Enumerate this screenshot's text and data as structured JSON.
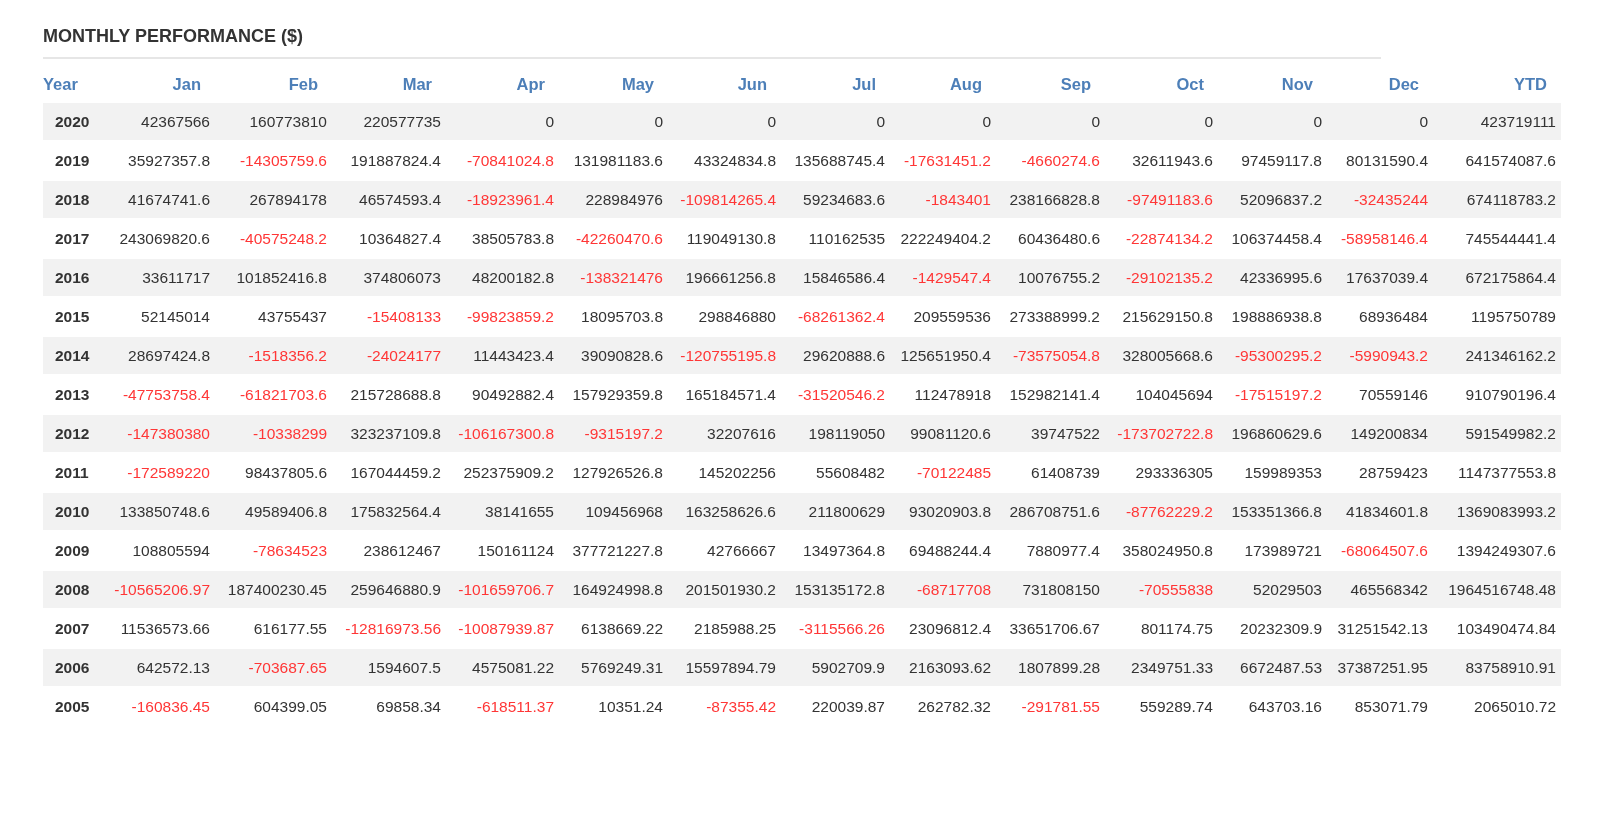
{
  "title": "MONTHLY PERFORMANCE ($)",
  "columns": [
    "Year",
    "Jan",
    "Feb",
    "Mar",
    "Apr",
    "May",
    "Jun",
    "Jul",
    "Aug",
    "Sep",
    "Oct",
    "Nov",
    "Dec",
    "YTD"
  ],
  "rows": [
    {
      "year": "2020",
      "cells": [
        {
          "text": "42367566",
          "negative": false
        },
        {
          "text": "160773810",
          "negative": false
        },
        {
          "text": "220577735",
          "negative": false
        },
        {
          "text": "0",
          "negative": false
        },
        {
          "text": "0",
          "negative": false
        },
        {
          "text": "0",
          "negative": false
        },
        {
          "text": "0",
          "negative": false
        },
        {
          "text": "0",
          "negative": false
        },
        {
          "text": "0",
          "negative": false
        },
        {
          "text": "0",
          "negative": false
        },
        {
          "text": "0",
          "negative": false
        },
        {
          "text": "0",
          "negative": false
        },
        {
          "text": "423719111",
          "negative": false
        }
      ]
    },
    {
      "year": "2019",
      "cells": [
        {
          "text": "35927357.8",
          "negative": false
        },
        {
          "text": "-14305759.6",
          "negative": true
        },
        {
          "text": "191887824.4",
          "negative": false
        },
        {
          "text": "-70841024.8",
          "negative": true
        },
        {
          "text": "131981183.6",
          "negative": false
        },
        {
          "text": "43324834.8",
          "negative": false
        },
        {
          "text": "135688745.4",
          "negative": false
        },
        {
          "text": "-17631451.2",
          "negative": true
        },
        {
          "text": "-4660274.6",
          "negative": true
        },
        {
          "text": "32611943.6",
          "negative": false
        },
        {
          "text": "97459117.8",
          "negative": false
        },
        {
          "text": "80131590.4",
          "negative": false
        },
        {
          "text": "641574087.6",
          "negative": false
        }
      ]
    },
    {
      "year": "2018",
      "cells": [
        {
          "text": "41674741.6",
          "negative": false
        },
        {
          "text": "267894178",
          "negative": false
        },
        {
          "text": "46574593.4",
          "negative": false
        },
        {
          "text": "-18923961.4",
          "negative": true
        },
        {
          "text": "228984976",
          "negative": false
        },
        {
          "text": "-109814265.4",
          "negative": true
        },
        {
          "text": "59234683.6",
          "negative": false
        },
        {
          "text": "-1843401",
          "negative": true
        },
        {
          "text": "238166828.8",
          "negative": false
        },
        {
          "text": "-97491183.6",
          "negative": true
        },
        {
          "text": "52096837.2",
          "negative": false
        },
        {
          "text": "-32435244",
          "negative": true
        },
        {
          "text": "674118783.2",
          "negative": false
        }
      ]
    },
    {
      "year": "2017",
      "cells": [
        {
          "text": "243069820.6",
          "negative": false
        },
        {
          "text": "-40575248.2",
          "negative": true
        },
        {
          "text": "10364827.4",
          "negative": false
        },
        {
          "text": "38505783.8",
          "negative": false
        },
        {
          "text": "-42260470.6",
          "negative": true
        },
        {
          "text": "119049130.8",
          "negative": false
        },
        {
          "text": "110162535",
          "negative": false
        },
        {
          "text": "222249404.2",
          "negative": false
        },
        {
          "text": "60436480.6",
          "negative": false
        },
        {
          "text": "-22874134.2",
          "negative": true
        },
        {
          "text": "106374458.4",
          "negative": false
        },
        {
          "text": "-58958146.4",
          "negative": true
        },
        {
          "text": "745544441.4",
          "negative": false
        }
      ]
    },
    {
      "year": "2016",
      "cells": [
        {
          "text": "33611717",
          "negative": false
        },
        {
          "text": "101852416.8",
          "negative": false
        },
        {
          "text": "374806073",
          "negative": false
        },
        {
          "text": "48200182.8",
          "negative": false
        },
        {
          "text": "-138321476",
          "negative": true
        },
        {
          "text": "196661256.8",
          "negative": false
        },
        {
          "text": "15846586.4",
          "negative": false
        },
        {
          "text": "-1429547.4",
          "negative": true
        },
        {
          "text": "10076755.2",
          "negative": false
        },
        {
          "text": "-29102135.2",
          "negative": true
        },
        {
          "text": "42336995.6",
          "negative": false
        },
        {
          "text": "17637039.4",
          "negative": false
        },
        {
          "text": "672175864.4",
          "negative": false
        }
      ]
    },
    {
      "year": "2015",
      "cells": [
        {
          "text": "52145014",
          "negative": false
        },
        {
          "text": "43755437",
          "negative": false
        },
        {
          "text": "-15408133",
          "negative": true
        },
        {
          "text": "-99823859.2",
          "negative": true
        },
        {
          "text": "18095703.8",
          "negative": false
        },
        {
          "text": "298846880",
          "negative": false
        },
        {
          "text": "-68261362.4",
          "negative": true
        },
        {
          "text": "209559536",
          "negative": false
        },
        {
          "text": "273388999.2",
          "negative": false
        },
        {
          "text": "215629150.8",
          "negative": false
        },
        {
          "text": "198886938.8",
          "negative": false
        },
        {
          "text": "68936484",
          "negative": false
        },
        {
          "text": "1195750789",
          "negative": false
        }
      ]
    },
    {
      "year": "2014",
      "cells": [
        {
          "text": "28697424.8",
          "negative": false
        },
        {
          "text": "-1518356.2",
          "negative": true
        },
        {
          "text": "-24024177",
          "negative": true
        },
        {
          "text": "11443423.4",
          "negative": false
        },
        {
          "text": "39090828.6",
          "negative": false
        },
        {
          "text": "-120755195.8",
          "negative": true
        },
        {
          "text": "29620888.6",
          "negative": false
        },
        {
          "text": "125651950.4",
          "negative": false
        },
        {
          "text": "-73575054.8",
          "negative": true
        },
        {
          "text": "328005668.6",
          "negative": false
        },
        {
          "text": "-95300295.2",
          "negative": true
        },
        {
          "text": "-5990943.2",
          "negative": true
        },
        {
          "text": "241346162.2",
          "negative": false
        }
      ]
    },
    {
      "year": "2013",
      "cells": [
        {
          "text": "-47753758.4",
          "negative": true
        },
        {
          "text": "-61821703.6",
          "negative": true
        },
        {
          "text": "215728688.8",
          "negative": false
        },
        {
          "text": "90492882.4",
          "negative": false
        },
        {
          "text": "157929359.8",
          "negative": false
        },
        {
          "text": "165184571.4",
          "negative": false
        },
        {
          "text": "-31520546.2",
          "negative": true
        },
        {
          "text": "112478918",
          "negative": false
        },
        {
          "text": "152982141.4",
          "negative": false
        },
        {
          "text": "104045694",
          "negative": false
        },
        {
          "text": "-17515197.2",
          "negative": true
        },
        {
          "text": "70559146",
          "negative": false
        },
        {
          "text": "910790196.4",
          "negative": false
        }
      ]
    },
    {
      "year": "2012",
      "cells": [
        {
          "text": "-147380380",
          "negative": true
        },
        {
          "text": "-10338299",
          "negative": true
        },
        {
          "text": "323237109.8",
          "negative": false
        },
        {
          "text": "-106167300.8",
          "negative": true
        },
        {
          "text": "-9315197.2",
          "negative": true
        },
        {
          "text": "32207616",
          "negative": false
        },
        {
          "text": "198119050",
          "negative": false
        },
        {
          "text": "99081120.6",
          "negative": false
        },
        {
          "text": "39747522",
          "negative": false
        },
        {
          "text": "-173702722.8",
          "negative": true
        },
        {
          "text": "196860629.6",
          "negative": false
        },
        {
          "text": "149200834",
          "negative": false
        },
        {
          "text": "591549982.2",
          "negative": false
        }
      ]
    },
    {
      "year": "2011",
      "cells": [
        {
          "text": "-172589220",
          "negative": true
        },
        {
          "text": "98437805.6",
          "negative": false
        },
        {
          "text": "167044459.2",
          "negative": false
        },
        {
          "text": "252375909.2",
          "negative": false
        },
        {
          "text": "127926526.8",
          "negative": false
        },
        {
          "text": "145202256",
          "negative": false
        },
        {
          "text": "55608482",
          "negative": false
        },
        {
          "text": "-70122485",
          "negative": true
        },
        {
          "text": "61408739",
          "negative": false
        },
        {
          "text": "293336305",
          "negative": false
        },
        {
          "text": "159989353",
          "negative": false
        },
        {
          "text": "28759423",
          "negative": false
        },
        {
          "text": "1147377553.8",
          "negative": false
        }
      ]
    },
    {
      "year": "2010",
      "cells": [
        {
          "text": "133850748.6",
          "negative": false
        },
        {
          "text": "49589406.8",
          "negative": false
        },
        {
          "text": "175832564.4",
          "negative": false
        },
        {
          "text": "38141655",
          "negative": false
        },
        {
          "text": "109456968",
          "negative": false
        },
        {
          "text": "163258626.6",
          "negative": false
        },
        {
          "text": "211800629",
          "negative": false
        },
        {
          "text": "93020903.8",
          "negative": false
        },
        {
          "text": "286708751.6",
          "negative": false
        },
        {
          "text": "-87762229.2",
          "negative": true
        },
        {
          "text": "153351366.8",
          "negative": false
        },
        {
          "text": "41834601.8",
          "negative": false
        },
        {
          "text": "1369083993.2",
          "negative": false
        }
      ]
    },
    {
      "year": "2009",
      "cells": [
        {
          "text": "108805594",
          "negative": false
        },
        {
          "text": "-78634523",
          "negative": true
        },
        {
          "text": "238612467",
          "negative": false
        },
        {
          "text": "150161124",
          "negative": false
        },
        {
          "text": "377721227.8",
          "negative": false
        },
        {
          "text": "42766667",
          "negative": false
        },
        {
          "text": "13497364.8",
          "negative": false
        },
        {
          "text": "69488244.4",
          "negative": false
        },
        {
          "text": "7880977.4",
          "negative": false
        },
        {
          "text": "358024950.8",
          "negative": false
        },
        {
          "text": "173989721",
          "negative": false
        },
        {
          "text": "-68064507.6",
          "negative": true
        },
        {
          "text": "1394249307.6",
          "negative": false
        }
      ]
    },
    {
      "year": "2008",
      "cells": [
        {
          "text": "-10565206.97",
          "negative": true
        },
        {
          "text": "187400230.45",
          "negative": false
        },
        {
          "text": "259646880.9",
          "negative": false
        },
        {
          "text": "-101659706.7",
          "negative": true
        },
        {
          "text": "164924998.8",
          "negative": false
        },
        {
          "text": "201501930.2",
          "negative": false
        },
        {
          "text": "153135172.8",
          "negative": false
        },
        {
          "text": "-68717708",
          "negative": true
        },
        {
          "text": "731808150",
          "negative": false
        },
        {
          "text": "-70555838",
          "negative": true
        },
        {
          "text": "52029503",
          "negative": false
        },
        {
          "text": "465568342",
          "negative": false
        },
        {
          "text": "1964516748.48",
          "negative": false
        }
      ]
    },
    {
      "year": "2007",
      "cells": [
        {
          "text": "11536573.66",
          "negative": false
        },
        {
          "text": "616177.55",
          "negative": false
        },
        {
          "text": "-12816973.56",
          "negative": true
        },
        {
          "text": "-10087939.87",
          "negative": true
        },
        {
          "text": "6138669.22",
          "negative": false
        },
        {
          "text": "2185988.25",
          "negative": false
        },
        {
          "text": "-3115566.26",
          "negative": true
        },
        {
          "text": "23096812.4",
          "negative": false
        },
        {
          "text": "33651706.67",
          "negative": false
        },
        {
          "text": "801174.75",
          "negative": false
        },
        {
          "text": "20232309.9",
          "negative": false
        },
        {
          "text": "31251542.13",
          "negative": false
        },
        {
          "text": "103490474.84",
          "negative": false
        }
      ]
    },
    {
      "year": "2006",
      "cells": [
        {
          "text": "642572.13",
          "negative": false
        },
        {
          "text": "-703687.65",
          "negative": true
        },
        {
          "text": "1594607.5",
          "negative": false
        },
        {
          "text": "4575081.22",
          "negative": false
        },
        {
          "text": "5769249.31",
          "negative": false
        },
        {
          "text": "15597894.79",
          "negative": false
        },
        {
          "text": "5902709.9",
          "negative": false
        },
        {
          "text": "2163093.62",
          "negative": false
        },
        {
          "text": "1807899.28",
          "negative": false
        },
        {
          "text": "2349751.33",
          "negative": false
        },
        {
          "text": "6672487.53",
          "negative": false
        },
        {
          "text": "37387251.95",
          "negative": false
        },
        {
          "text": "83758910.91",
          "negative": false
        }
      ]
    },
    {
      "year": "2005",
      "cells": [
        {
          "text": "-160836.45",
          "negative": true
        },
        {
          "text": "604399.05",
          "negative": false
        },
        {
          "text": "69858.34",
          "negative": false
        },
        {
          "text": "-618511.37",
          "negative": true
        },
        {
          "text": "10351.24",
          "negative": false
        },
        {
          "text": "-87355.42",
          "negative": true
        },
        {
          "text": "220039.87",
          "negative": false
        },
        {
          "text": "262782.32",
          "negative": false
        },
        {
          "text": "-291781.55",
          "negative": true
        },
        {
          "text": "559289.74",
          "negative": false
        },
        {
          "text": "643703.16",
          "negative": false
        },
        {
          "text": "853071.79",
          "negative": false
        },
        {
          "text": "2065010.72",
          "negative": false
        }
      ]
    }
  ]
}
